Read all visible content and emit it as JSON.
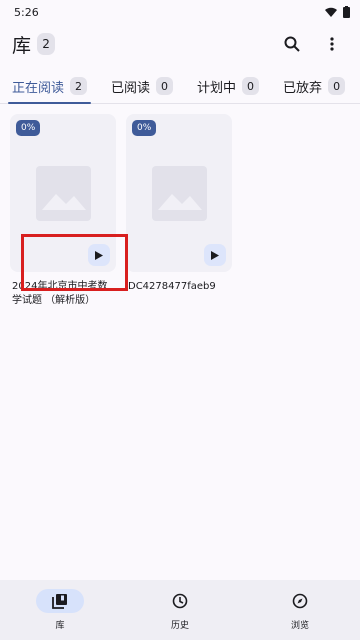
{
  "status": {
    "time": "5:26"
  },
  "header": {
    "title": "库",
    "count": "2",
    "search_icon": "search-icon",
    "more_icon": "more-vert-icon"
  },
  "tabs": [
    {
      "label": "正在阅读",
      "count": "2",
      "active": true
    },
    {
      "label": "已阅读",
      "count": "0"
    },
    {
      "label": "计划中",
      "count": "0"
    },
    {
      "label": "已放弃",
      "count": "0"
    }
  ],
  "books": [
    {
      "title": "2024年北京市中考数学试题 （解析版）",
      "progress": "0%"
    },
    {
      "title": "DC4278477faeb9",
      "progress": "0%"
    }
  ],
  "nav": [
    {
      "label": "库",
      "icon": "library-icon",
      "active": true
    },
    {
      "label": "历史",
      "icon": "history-icon"
    },
    {
      "label": "浏览",
      "icon": "compass-icon"
    }
  ],
  "colors": {
    "accent": "#3f5b99",
    "highlight": "#d81f1f"
  }
}
